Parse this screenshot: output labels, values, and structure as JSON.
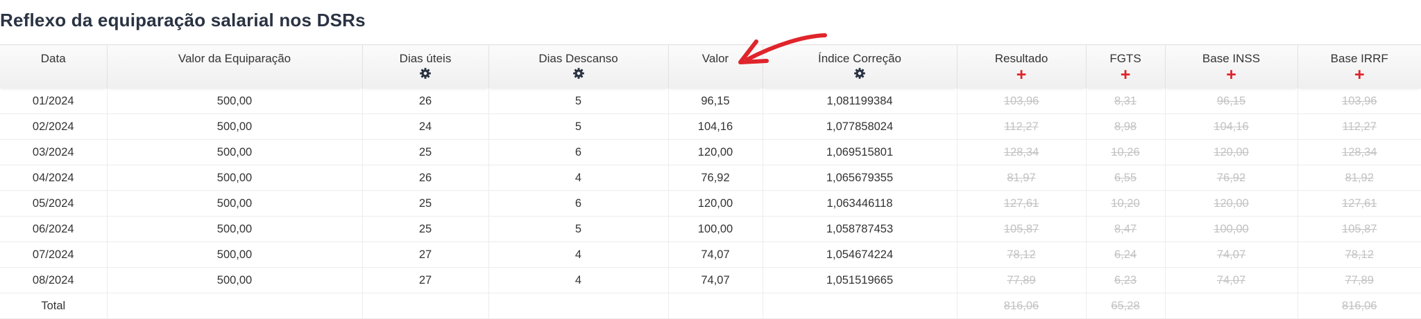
{
  "title": "Reflexo da equiparação salarial nos DSRs",
  "columns": [
    {
      "label": "Data",
      "icon": ""
    },
    {
      "label": "Valor da Equiparação",
      "icon": ""
    },
    {
      "label": "Dias úteis",
      "icon": "gear-icon"
    },
    {
      "label": "Dias Descanso",
      "icon": "gear-icon"
    },
    {
      "label": "Valor",
      "icon": ""
    },
    {
      "label": "Índice Correção",
      "icon": "gear-icon"
    },
    {
      "label": "Resultado",
      "icon": "plus-icon"
    },
    {
      "label": "FGTS",
      "icon": "plus-icon"
    },
    {
      "label": "Base INSS",
      "icon": "plus-icon"
    },
    {
      "label": "Base IRRF",
      "icon": "plus-icon"
    }
  ],
  "plus_symbol": "+",
  "rows": [
    [
      "01/2024",
      "500,00",
      "26",
      "5",
      "96,15",
      "1,081199384",
      "103,96",
      "8,31",
      "96,15",
      "103,96"
    ],
    [
      "02/2024",
      "500,00",
      "24",
      "5",
      "104,16",
      "1,077858024",
      "112,27",
      "8,98",
      "104,16",
      "112,27"
    ],
    [
      "03/2024",
      "500,00",
      "25",
      "6",
      "120,00",
      "1,069515801",
      "128,34",
      "10,26",
      "120,00",
      "128,34"
    ],
    [
      "04/2024",
      "500,00",
      "26",
      "4",
      "76,92",
      "1,065679355",
      "81,97",
      "6,55",
      "76,92",
      "81,92"
    ],
    [
      "05/2024",
      "500,00",
      "25",
      "6",
      "120,00",
      "1,063446118",
      "127,61",
      "10,20",
      "120,00",
      "127,61"
    ],
    [
      "06/2024",
      "500,00",
      "25",
      "5",
      "100,00",
      "1,058787453",
      "105,87",
      "8,47",
      "100,00",
      "105,87"
    ],
    [
      "07/2024",
      "500,00",
      "27",
      "4",
      "74,07",
      "1,054674224",
      "78,12",
      "6,24",
      "74,07",
      "78,12"
    ],
    [
      "08/2024",
      "500,00",
      "27",
      "4",
      "74,07",
      "1,051519665",
      "77,89",
      "6,23",
      "74,07",
      "77,89"
    ]
  ],
  "total_row": [
    "Total",
    "",
    "",
    "",
    "",
    "",
    "816,06",
    "65,28",
    "",
    "816,06"
  ],
  "colors": {
    "title": "#2a3342",
    "plus_icon": "#e0242b",
    "arrow": "#e0242b",
    "struck_text": "#c2c2c2"
  }
}
